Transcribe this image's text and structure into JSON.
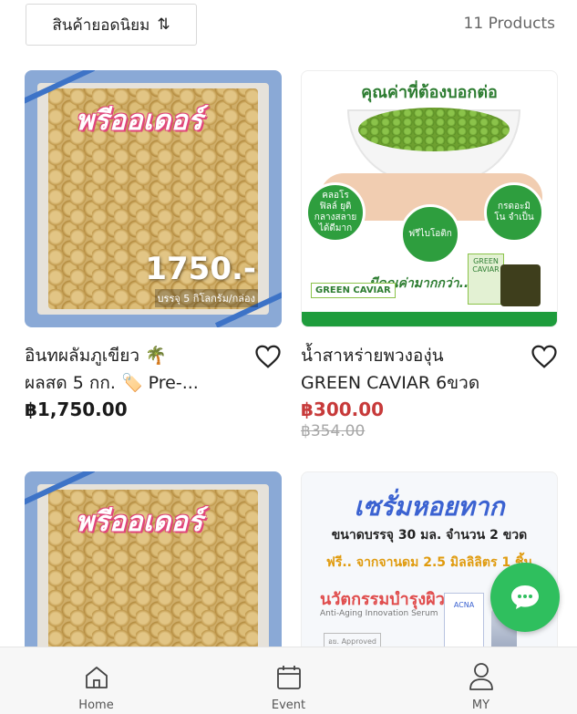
{
  "toolbar": {
    "sort_label": "สินค้ายอดนิยม",
    "sort_icon": "sort-arrows-icon",
    "product_count": "11 Products"
  },
  "products": [
    {
      "image_badge": "พรีออเดอร์",
      "image_price": "1750.-",
      "image_subtext": "บรรจุ 5 กิโลกรัม/กล่อง",
      "name_line1": "อินทผลัมภูเขียว 🌴",
      "name_line2": "ผลสด 5 กก. 🏷️ Pre-...",
      "price": "฿1,750.00"
    },
    {
      "image_headline": "คุณค่าที่ต้องบอกต่อ",
      "image_bubbles": [
        "คลอโรฟิลล์ ยุติกลางสลาย ได้ดีมาก",
        "ฟรีไบโอติก",
        "กรดอะมิโน จำเป็น"
      ],
      "image_tagline": "มีคุณค่ามากกว่า... อร่อย...",
      "image_logo": "GREEN CAVIAR",
      "name_line1": "น้ำสาหร่ายพวงองุ่น",
      "name_line2": "GREEN CAVIAR 6ขวด",
      "price": "฿300.00",
      "old_price": "฿354.00"
    },
    {
      "image_badge": "พรีออเดอร์"
    },
    {
      "image_headline": "เซรั่มหอยทาก",
      "image_line1": "ขนาดบรรจุ 30 มล. จำนวน 2 ขวด",
      "image_line2": "ฟรี.. จากจานดม 2.5 มิลลิลิตร 1 ชิ้น",
      "image_brand": "นวัตกรรมบำรุงผิว",
      "image_brand_sub": "Anti-Aging Innovation Serum",
      "image_fda": "อย. Approved",
      "image_box_label": "ACNA"
    }
  ],
  "nav": {
    "home_label": "Home",
    "event_label": "Event",
    "my_label": "MY"
  },
  "colors": {
    "sale_price": "#c73a3a",
    "chat_fab": "#2fbf5e"
  }
}
